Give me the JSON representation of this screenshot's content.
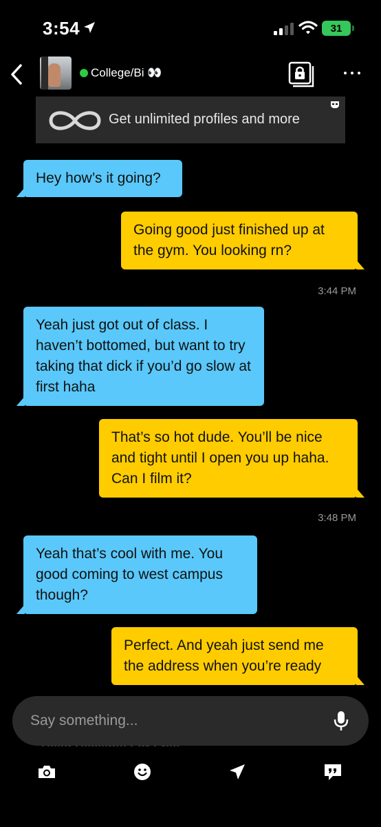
{
  "status_bar": {
    "time": "3:54",
    "battery": "31"
  },
  "header": {
    "profile_name": "College/Bi 👀"
  },
  "promo": {
    "text": "Get unlimited profiles and more"
  },
  "messages": [
    {
      "direction": "in",
      "text": "Hey how’s it going?"
    },
    {
      "direction": "out",
      "text": "Going good just finished up at the gym. You looking rn?",
      "time": "3:44 PM"
    },
    {
      "direction": "in",
      "text": "Yeah just got out of class. I haven’t bottomed, but want to try taking that dick if you’d go slow at first haha"
    },
    {
      "direction": "out",
      "text": "That’s so hot dude. You’ll be nice and tight until I open you up haha. Can I film it?",
      "time": "3:48 PM"
    },
    {
      "direction": "in",
      "text": "Yeah that’s cool with me. You good coming to west campus though?"
    },
    {
      "direction": "out",
      "text": "Perfect. And yeah just send me the address when you’re ready"
    }
  ],
  "composer": {
    "placeholder": "Say something...",
    "value": ""
  },
  "read_receipts_banner": "Read Receipts For Free",
  "toolbar": {
    "items": [
      "camera-icon",
      "emoji-icon",
      "location-icon",
      "saved-phrases-icon"
    ]
  },
  "colors": {
    "incoming_bubble": "#5ac8fa",
    "outgoing_bubble": "#ffcc00",
    "online": "#2ecc40",
    "background": "#000000"
  }
}
